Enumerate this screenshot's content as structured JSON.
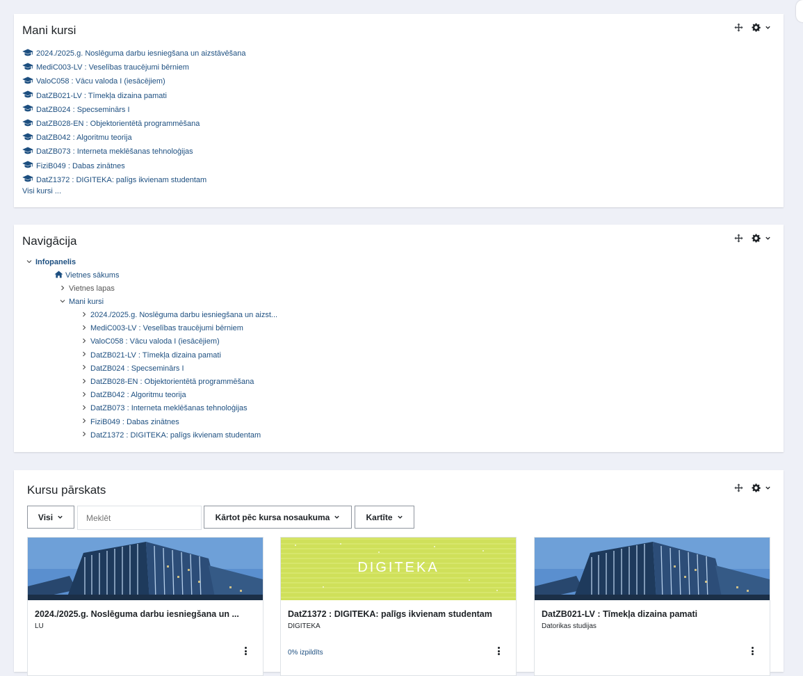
{
  "mani_kursi": {
    "title": "Mani kursi",
    "courses": [
      "2024./2025.g. Noslēguma darbu iesniegšana un aizstāvēšana",
      "MediC003-LV : Veselības traucējumi bērniem",
      "ValoC058 : Vācu valoda I (iesācējiem)",
      "DatZB021-LV : Tīmekļa dizaina pamati",
      "DatZB024 : Specseminārs I",
      "DatZB028-EN : Objektorientētā programmēšana",
      "DatZB042 : Algoritmu teorija",
      "DatZB073 : Interneta meklēšanas tehnoloģijas",
      "FiziB049 : Dabas zinātnes",
      "DatZ1372 : DIGITEKA: palīgs ikvienam studentam"
    ],
    "all_courses": "Visi kursi ..."
  },
  "navigacija": {
    "title": "Navigācija",
    "root": "Infopanelis",
    "site_home": "Vietnes sākums",
    "site_pages": "Vietnes lapas",
    "my_courses": "Mani kursi",
    "courses": [
      "2024./2025.g. Noslēguma darbu iesniegšana un aizst...",
      "MediC003-LV : Veselības traucējumi bērniem",
      "ValoC058 : Vācu valoda I (iesācējiem)",
      "DatZB021-LV : Tīmekļa dizaina pamati",
      "DatZB024 : Specseminārs I",
      "DatZB028-EN : Objektorientētā programmēšana",
      "DatZB042 : Algoritmu teorija",
      "DatZB073 : Interneta meklēšanas tehnoloģijas",
      "FiziB049 : Dabas zinātnes",
      "DatZ1372 : DIGITEKA: palīgs ikvienam studentam"
    ]
  },
  "overview": {
    "title": "Kursu pārskats",
    "filter_label": "Visi",
    "search_placeholder": "Meklēt",
    "sort_label": "Kārtot pēc kursa nosaukuma",
    "view_label": "Kartīte",
    "cards": [
      {
        "title": "2024./2025.g. Noslēguma darbu iesniegšana un ...",
        "category": "LU",
        "progress": "",
        "image": "building"
      },
      {
        "title": "DatZ1372 : DIGITEKA: palīgs ikvienam studentam",
        "category": "DIGITEKA",
        "progress": "0% izpildīts",
        "image": "digiteka"
      },
      {
        "title": "DatZB021-LV : Tīmekļa dizaina pamati",
        "category": "Datorikas studijas",
        "progress": "",
        "image": "building"
      }
    ],
    "digiteka_logo": "DIGITEKA"
  },
  "colors": {
    "link": "#1d4f80",
    "page_bg": "#eef0f7",
    "digiteka_bg": "#cfe05a"
  }
}
